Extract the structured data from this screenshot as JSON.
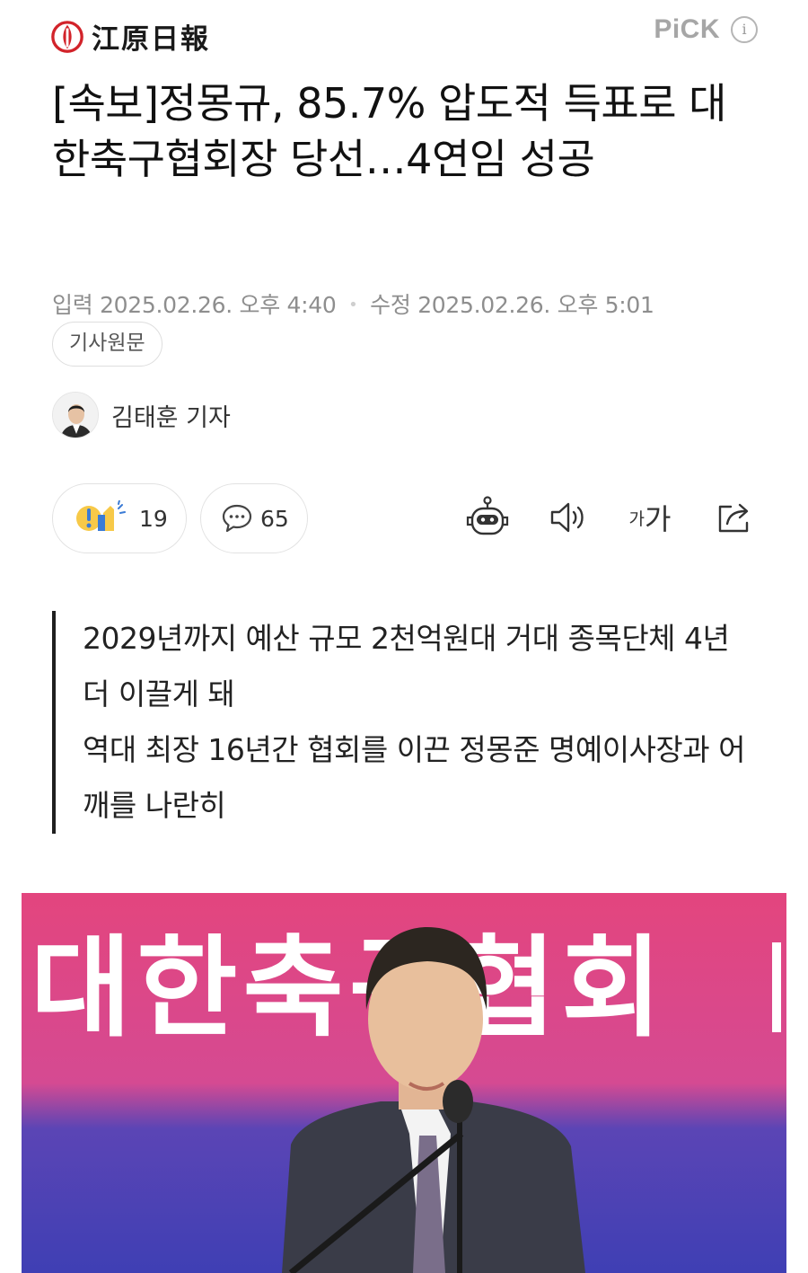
{
  "header": {
    "logo_text": "江原日報",
    "pick_label": "PiCK",
    "info_label": "i"
  },
  "article": {
    "title": "[속보]정몽규, 85.7% 압도적 득표로 대한축구협회장 당선…4연임 성공",
    "input_label": "입력",
    "input_date": "2025.02.26. 오후 4:40",
    "modified_label": "수정",
    "modified_date": "2025.02.26. 오후 5:01",
    "original_button": "기사원문",
    "reporter": "김태훈 기자"
  },
  "actions": {
    "reaction_count": "19",
    "comment_count": "65",
    "font_small": "가",
    "font_large": "가"
  },
  "summary": [
    "2029년까지 예산 규모 2천억원대 거대 종목단체 4년 더 이끌게 돼",
    "역대 최장 16년간 협회를 이끈 정몽준 명예이사장과 어깨를 나란히"
  ],
  "photo": {
    "banner_text": "대한축구협회"
  },
  "colors": {
    "logo_red": "#d2232a",
    "banner_pink": "#e0457f",
    "banner_blue": "#3f3fb4",
    "reaction_yellow": "#f7c948",
    "reaction_blue": "#3a7bd5"
  }
}
